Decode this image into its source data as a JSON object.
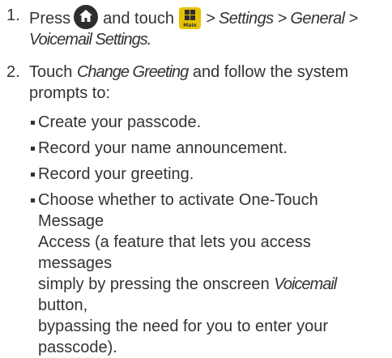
{
  "steps": [
    {
      "number": "1.",
      "parts": {
        "press": "Press",
        "and_touch": "and touch",
        "main_icon_label": "Main",
        "path1": "> Settings > General >",
        "path2": "Voicemail Settings."
      }
    },
    {
      "number": "2.",
      "parts": {
        "touch": "Touch",
        "change_greeting": "Change Greeting",
        "rest1": "and follow the system",
        "rest2": "prompts to:"
      }
    }
  ],
  "bullets": [
    {
      "lines": [
        "Create your passcode."
      ]
    },
    {
      "lines": [
        "Record your name announcement."
      ]
    },
    {
      "lines": [
        "Record your greeting."
      ]
    },
    {
      "lines": [
        "Choose whether to activate One-Touch Message",
        "Access (a feature that lets you access messages",
        "simply by pressing the onscreen",
        "button,",
        "bypassing the need for you to enter your",
        "passcode)."
      ],
      "voicemail_label": "Voicemail"
    }
  ],
  "icons": {
    "home": "home-icon",
    "main": "main-menu-icon"
  },
  "colors": {
    "text": "#333333",
    "main_icon_bg": "#e6c200",
    "home_icon_bg": "#2d2d2d"
  }
}
